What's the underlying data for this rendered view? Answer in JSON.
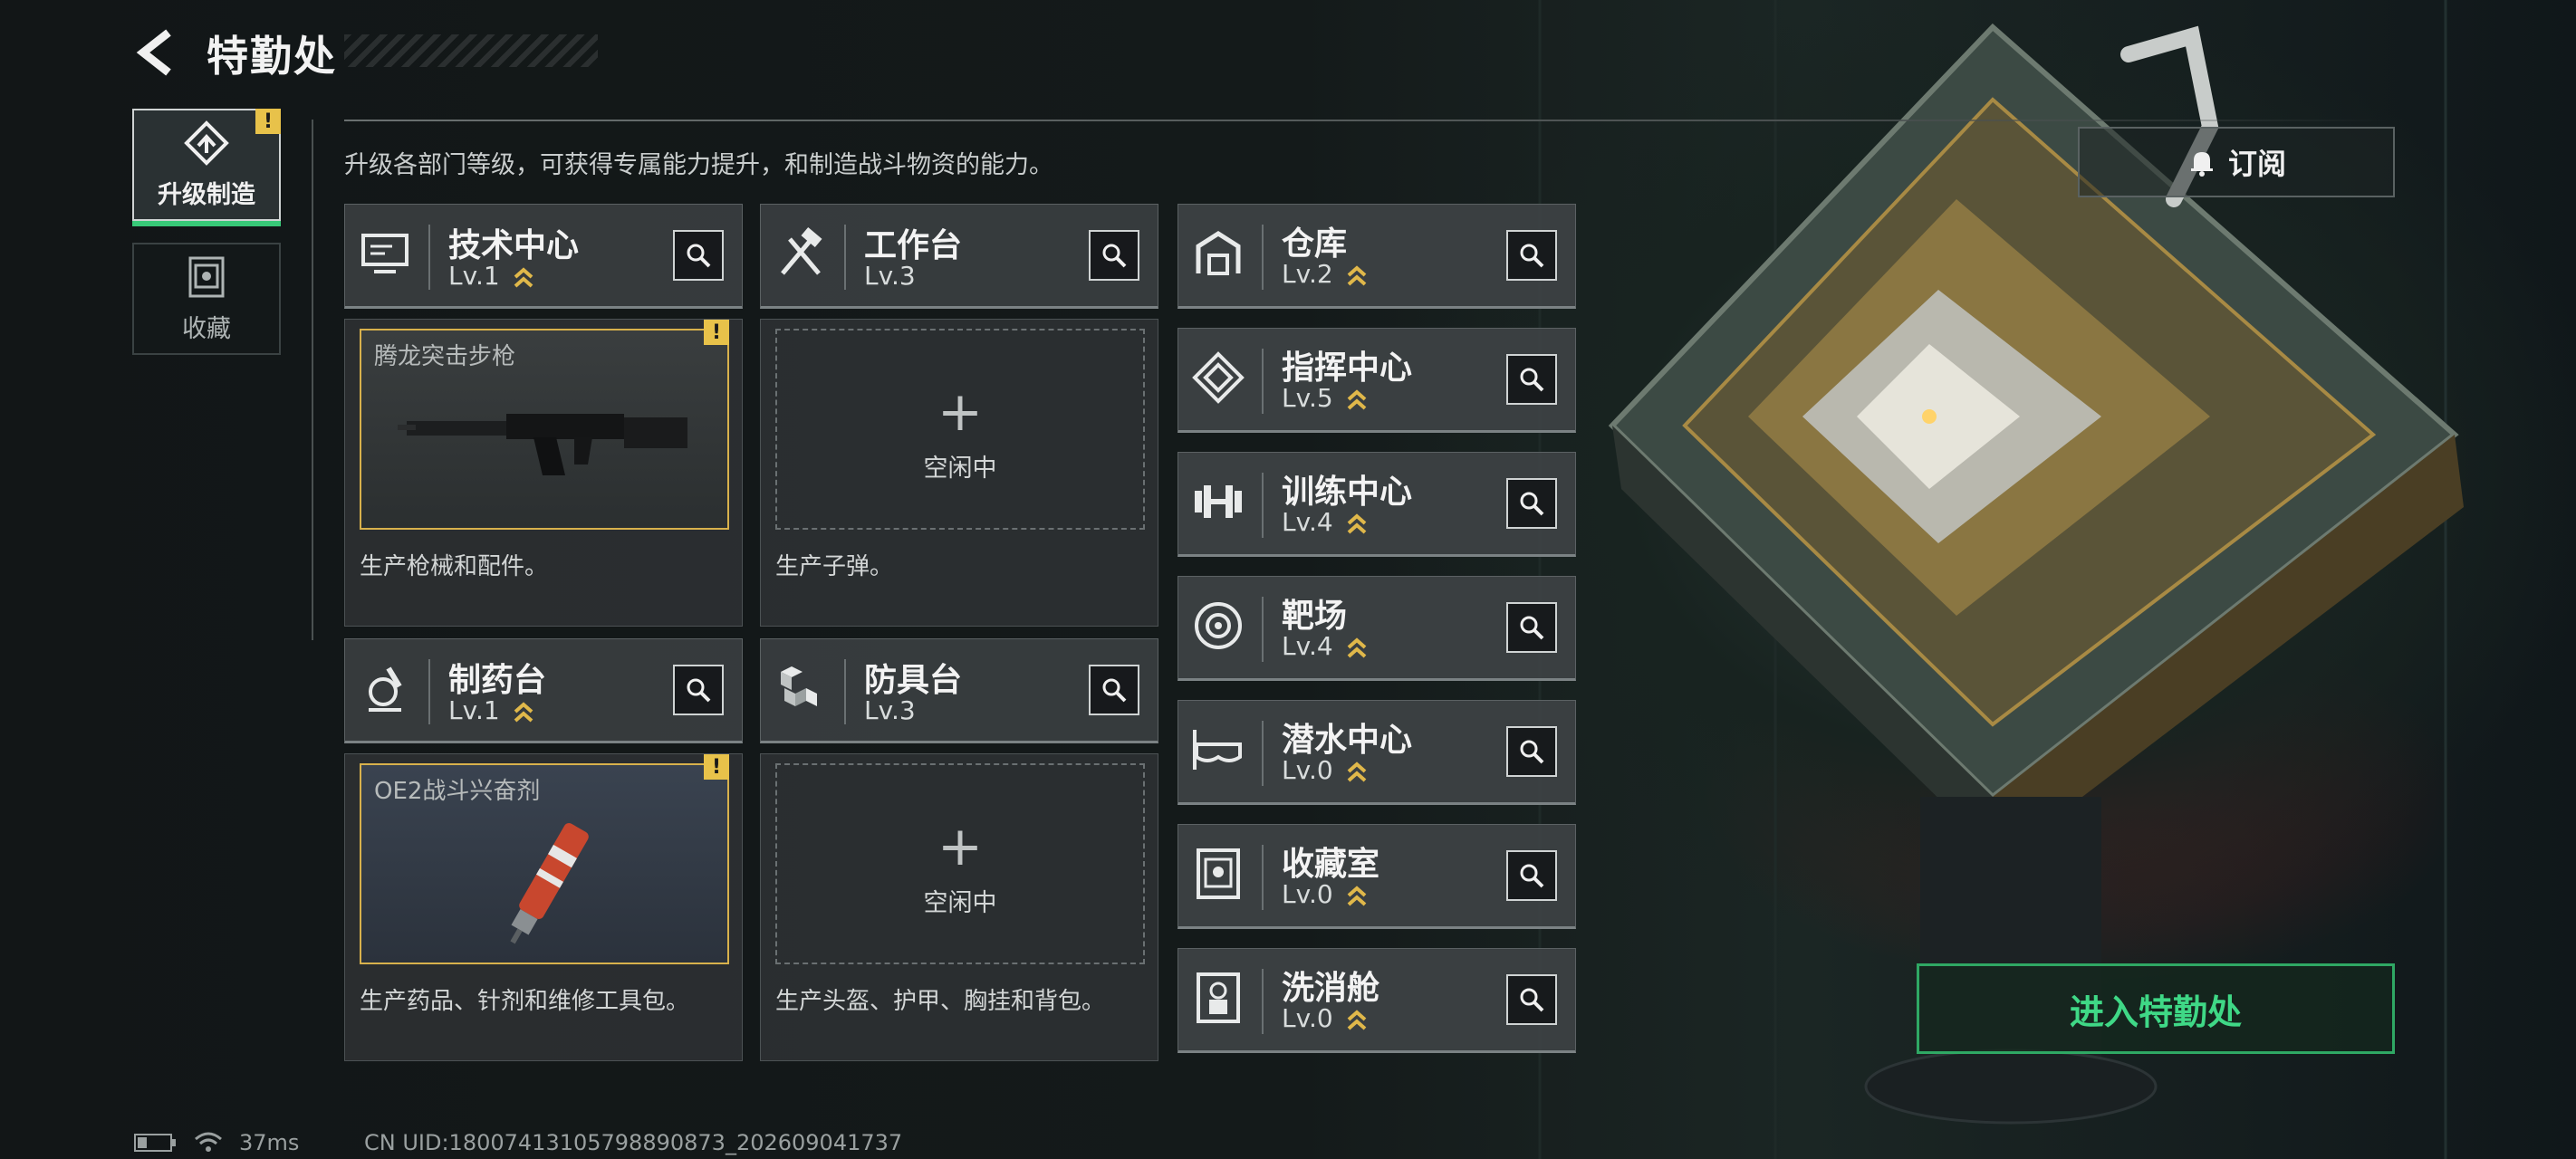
{
  "header": {
    "title": "特勤处"
  },
  "tabs": [
    {
      "label": "升级制造",
      "icon": "upgrade-icon",
      "active": true,
      "badge": "!"
    },
    {
      "label": "收藏",
      "icon": "collection-icon",
      "active": false
    }
  ],
  "description": "升级各部门等级，可获得专属能力提升，和制造战斗物资的能力。",
  "workshops": [
    {
      "name": "技术中心",
      "level": "Lv.1",
      "upgradable": true,
      "icon": "monitor-icon",
      "slot": {
        "state": "filled",
        "item": "腾龙突击步枪",
        "badge": "!"
      },
      "desc": "生产枪械和配件。"
    },
    {
      "name": "工作台",
      "level": "Lv.3",
      "upgradable": false,
      "icon": "tools-icon",
      "slot": {
        "state": "empty",
        "plus": "+",
        "idle": "空闲中"
      },
      "desc": "生产子弹。"
    },
    {
      "name": "制药台",
      "level": "Lv.1",
      "upgradable": true,
      "icon": "microscope-icon",
      "slot": {
        "state": "filled",
        "item": "OE2战斗兴奋剂",
        "badge": "!"
      },
      "desc": "生产药品、针剂和维修工具包。"
    },
    {
      "name": "防具台",
      "level": "Lv.3",
      "upgradable": false,
      "icon": "armor-cubes-icon",
      "slot": {
        "state": "empty",
        "plus": "+",
        "idle": "空闲中"
      },
      "desc": "生产头盔、护甲、胸挂和背包。"
    }
  ],
  "departments": [
    {
      "name": "仓库",
      "level": "Lv.2",
      "icon": "warehouse-icon"
    },
    {
      "name": "指挥中心",
      "level": "Lv.5",
      "icon": "command-diamond-icon"
    },
    {
      "name": "训练中心",
      "level": "Lv.4",
      "icon": "dumbbell-icon"
    },
    {
      "name": "靶场",
      "level": "Lv.4",
      "icon": "target-icon"
    },
    {
      "name": "潜水中心",
      "level": "Lv.0",
      "icon": "diving-mask-icon"
    },
    {
      "name": "收藏室",
      "level": "Lv.0",
      "icon": "collection-room-icon"
    },
    {
      "name": "洗消舱",
      "level": "Lv.0",
      "icon": "decon-chamber-icon"
    }
  ],
  "subscribe": {
    "label": "订阅",
    "icon": "bell-icon"
  },
  "enter_button": "进入特勤处",
  "status": {
    "ping": "37ms",
    "uid": "CN UID:18007413105798890873_202609041737"
  },
  "colors": {
    "accent_green": "#38c978",
    "enter_green": "#3fd886",
    "badge_yellow": "#e8c24a",
    "upgrade_yellow": "#e0b84a"
  }
}
